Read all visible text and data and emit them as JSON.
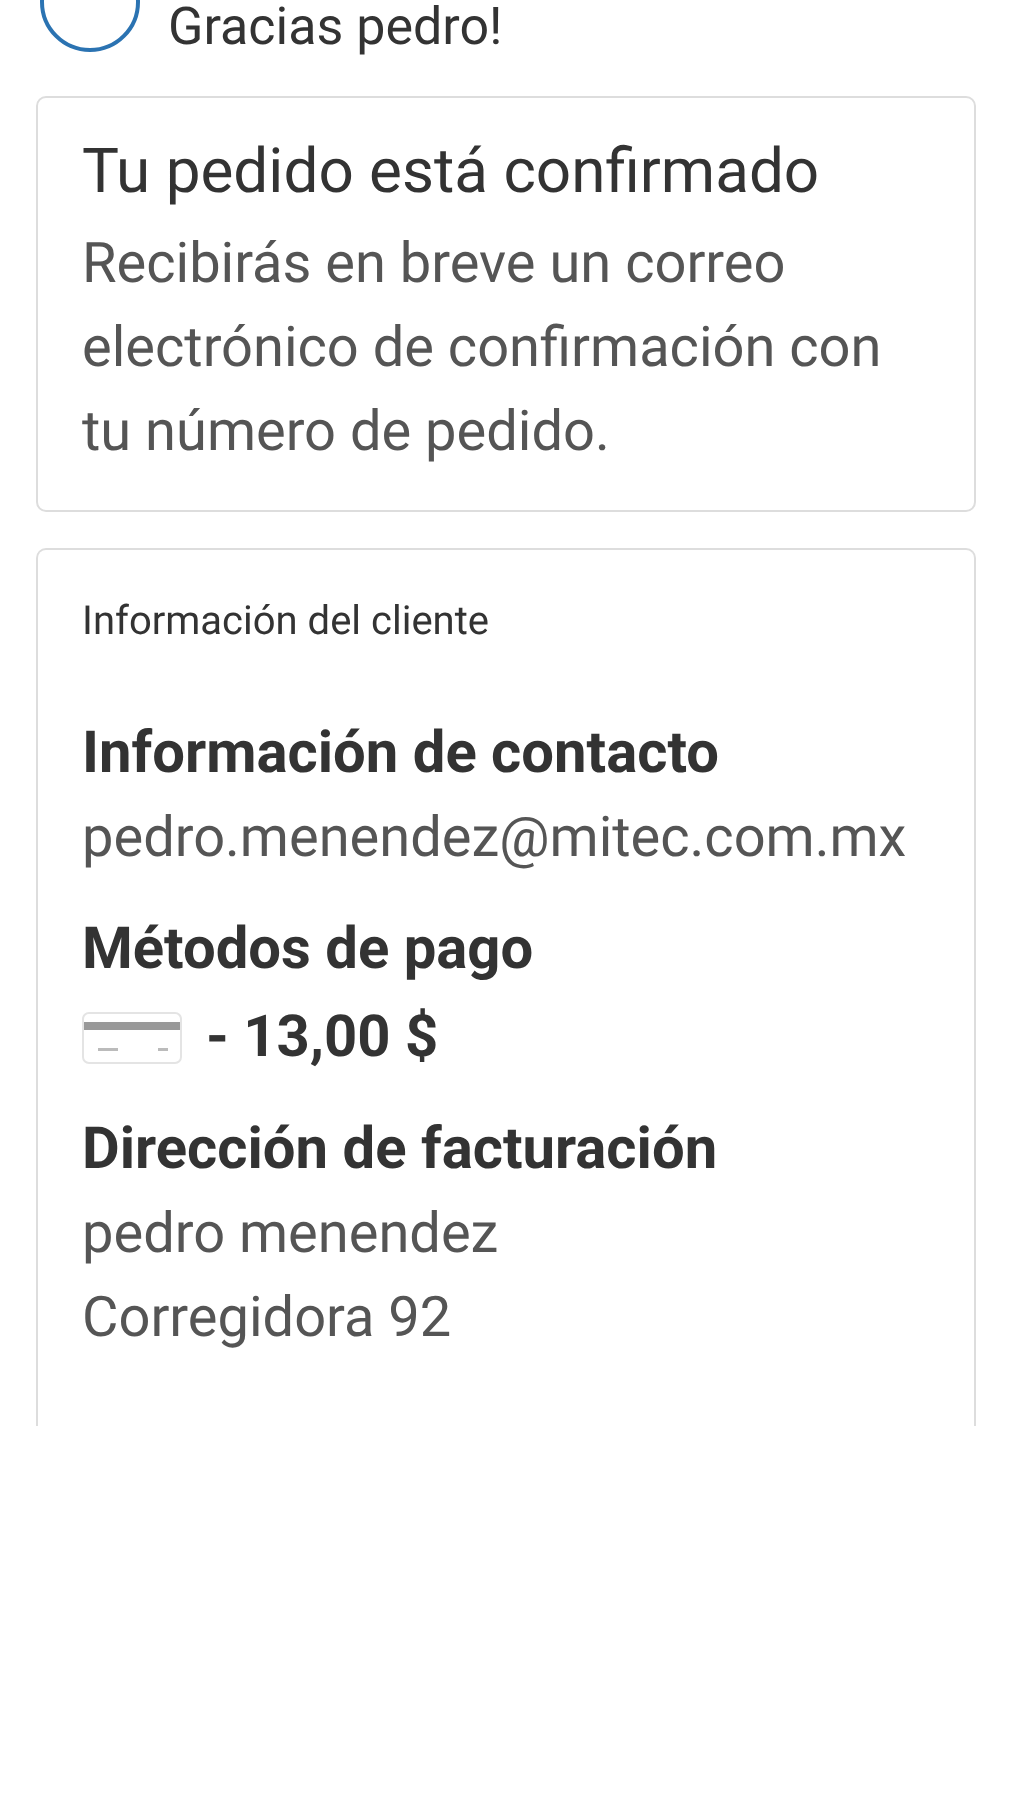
{
  "header": {
    "title": "Gracias pedro!"
  },
  "confirmation": {
    "title": "Tu pedido está confirmado",
    "message": "Recibirás en breve un correo electrónico de confirmación con tu número de pedido."
  },
  "customer": {
    "title": "Información del cliente",
    "sections": [
      {
        "kind": "text",
        "heading": "Información de contacto",
        "lines": [
          "pedro.menendez@mitec.com.mx"
        ]
      },
      {
        "kind": "payment",
        "heading": "Métodos de pago",
        "lines": [
          "- 13,00 $"
        ]
      },
      {
        "kind": "text",
        "heading": "Dirección de facturación",
        "lines": [
          "pedro menendez",
          "Corregidora 92"
        ]
      }
    ]
  }
}
